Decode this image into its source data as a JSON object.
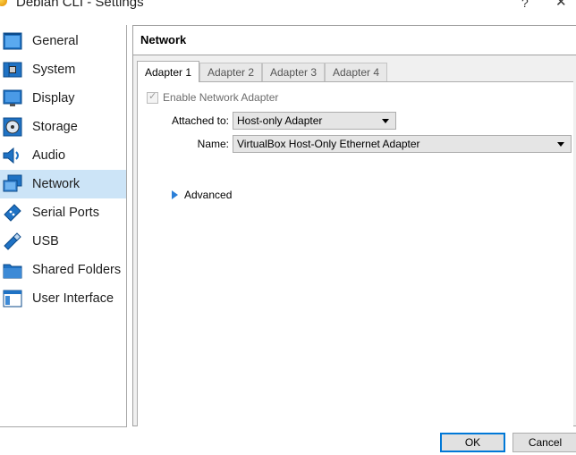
{
  "window": {
    "title": "Debian CLI - Settings",
    "help_label": "?",
    "close_label": "✕"
  },
  "sidebar": {
    "items": [
      {
        "label": "General",
        "icon": "general-icon",
        "selected": false
      },
      {
        "label": "System",
        "icon": "system-chip-icon",
        "selected": false
      },
      {
        "label": "Display",
        "icon": "display-monitor-icon",
        "selected": false
      },
      {
        "label": "Storage",
        "icon": "storage-disk-icon",
        "selected": false
      },
      {
        "label": "Audio",
        "icon": "audio-speaker-icon",
        "selected": false
      },
      {
        "label": "Network",
        "icon": "network-icon",
        "selected": true
      },
      {
        "label": "Serial Ports",
        "icon": "serial-port-icon",
        "selected": false
      },
      {
        "label": "USB",
        "icon": "usb-icon",
        "selected": false
      },
      {
        "label": "Shared Folders",
        "icon": "shared-folder-icon",
        "selected": false
      },
      {
        "label": "User Interface",
        "icon": "user-interface-icon",
        "selected": false
      }
    ]
  },
  "section": {
    "title": "Network"
  },
  "tabs": [
    {
      "label": "Adapter 1",
      "active": true
    },
    {
      "label": "Adapter 2",
      "active": false
    },
    {
      "label": "Adapter 3",
      "active": false
    },
    {
      "label": "Adapter 4",
      "active": false
    }
  ],
  "adapter": {
    "enable_label": "Enable Network Adapter",
    "enable_checked": true,
    "enable_disabled": true,
    "attached_label": "Attached to:",
    "attached_value": "Host-only Adapter",
    "name_label": "Name:",
    "name_value": "VirtualBox Host-Only Ethernet Adapter",
    "advanced_label": "Advanced"
  },
  "buttons": {
    "ok": "OK",
    "cancel": "Cancel"
  },
  "colors": {
    "selection": "#cce4f7",
    "pane_background": "#f0f0f0",
    "default_button_border": "#0078d7",
    "icon_blue": "#1f72c4"
  }
}
